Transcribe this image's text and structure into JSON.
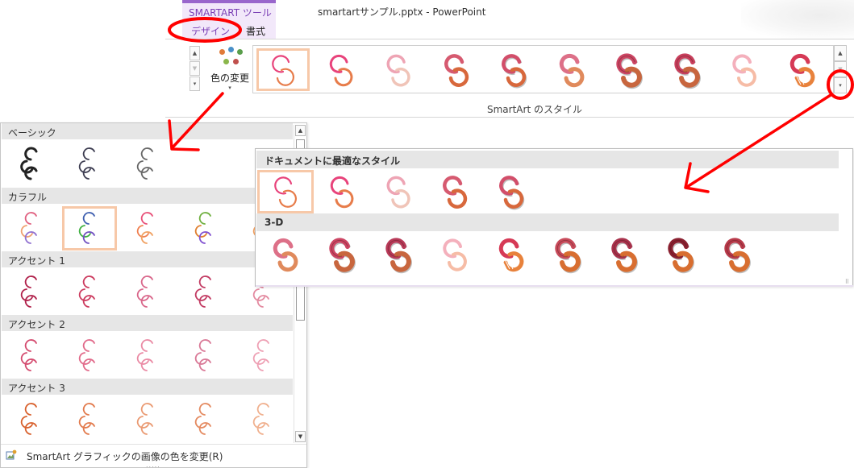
{
  "ribbon": {
    "contextual_tab_label": "SMARTART ツール",
    "tabs": [
      {
        "label": "デザイン",
        "active": true
      },
      {
        "label": "書式",
        "active": false
      }
    ],
    "document_title": "smartartサンプル.pptx - PowerPoint",
    "color_change": {
      "label": "色の変更",
      "dropdown": "▾",
      "dot_colors": [
        "#e07b39",
        "#4a90c8",
        "#5a9e4b",
        "#8ab64a",
        "#c0504d"
      ]
    },
    "style_group_label": "SmartArt のスタイル",
    "scroll_up": "▲",
    "scroll_down": "▼",
    "more": "▾",
    "style_gallery": [
      {
        "style": "flat-thin",
        "color": "#e8437b",
        "selected": true
      },
      {
        "style": "flat-thick",
        "color": "#e8437b"
      },
      {
        "style": "soft",
        "color": "#eea4b4"
      },
      {
        "style": "bevel",
        "color": "#d65a70"
      },
      {
        "style": "shadow",
        "color": "#d24e6a"
      },
      {
        "style": "soft-bevel",
        "color": "#dd7088"
      },
      {
        "style": "3d-thick",
        "color": "#cc4563"
      },
      {
        "style": "textured",
        "color": "#c83f5c"
      },
      {
        "style": "light",
        "color": "#f2a0b0"
      },
      {
        "style": "striped",
        "color": "#d63a56"
      }
    ]
  },
  "color_menu": {
    "sections": [
      {
        "label": "ベーシック",
        "items": [
          {
            "colors": [
              "#222222"
            ]
          },
          {
            "colors": [
              "#3c3c50"
            ]
          },
          {
            "colors": [
              "#666666"
            ]
          }
        ]
      },
      {
        "label": "カラフル",
        "items": [
          {
            "colors": [
              "#e06080",
              "#f0a070",
              "#9070d0"
            ]
          },
          {
            "colors": [
              "#4060b0",
              "#3fb040",
              "#7050c0"
            ],
            "selected": true
          },
          {
            "colors": [
              "#e85078",
              "#f08050",
              "#f0a060"
            ]
          },
          {
            "colors": [
              "#70b040",
              "#e08030",
              "#8050d0"
            ]
          },
          {
            "colors": [
              "#e05070",
              "#f0a060",
              "#9060c0"
            ]
          }
        ]
      },
      {
        "label": "アクセント 1",
        "items": [
          {
            "colors": [
              "#b0204a"
            ]
          },
          {
            "colors": [
              "#cc3a5e"
            ]
          },
          {
            "colors": [
              "#d9668a"
            ]
          },
          {
            "colors": [
              "#c23a62"
            ]
          },
          {
            "colors": [
              "#e38aa0"
            ]
          }
        ]
      },
      {
        "label": "アクセント 2",
        "items": [
          {
            "colors": [
              "#d44a6e"
            ]
          },
          {
            "colors": [
              "#e16a8a"
            ]
          },
          {
            "colors": [
              "#ea8aa4"
            ]
          },
          {
            "colors": [
              "#d97896"
            ]
          },
          {
            "colors": [
              "#eea0b4"
            ]
          }
        ]
      },
      {
        "label": "アクセント 3",
        "items": [
          {
            "colors": [
              "#d8602c"
            ]
          },
          {
            "colors": [
              "#e27a4c"
            ]
          },
          {
            "colors": [
              "#ea9a72"
            ]
          },
          {
            "colors": [
              "#e48a60"
            ]
          },
          {
            "colors": [
              "#f0b08e"
            ]
          }
        ]
      }
    ],
    "scroll_up": "▲",
    "scroll_down": "▼",
    "footer_text": "SmartArt グラフィックの画像の色を変更(R)",
    "footer_grip": "....."
  },
  "style_menu": {
    "sections": [
      {
        "label": "ドキュメントに最適なスタイル",
        "items": [
          {
            "style": "flat-thin",
            "color": "#e8437b",
            "selected": true
          },
          {
            "style": "flat-thick",
            "color": "#e8437b"
          },
          {
            "style": "soft",
            "color": "#eea4b4"
          },
          {
            "style": "bevel",
            "color": "#d65a70"
          },
          {
            "style": "shadow",
            "color": "#d24e6a"
          }
        ]
      },
      {
        "label": "3-D",
        "items": [
          {
            "style": "soft-bevel",
            "color": "#dd7088"
          },
          {
            "style": "3d-thick",
            "color": "#cc4563"
          },
          {
            "style": "textured",
            "color": "#b83a58"
          },
          {
            "style": "light",
            "color": "#f2a0b0"
          },
          {
            "style": "striped",
            "color": "#d63a56"
          },
          {
            "style": "perspective",
            "color": "#c84a5a"
          },
          {
            "style": "perspective-dark",
            "color": "#a8324c"
          },
          {
            "style": "dark-3d",
            "color": "#8a2030"
          },
          {
            "style": "solid-3d",
            "color": "#b83a4a"
          }
        ]
      }
    ],
    "grip": "⠿"
  },
  "annotation_color": "#ff0000"
}
